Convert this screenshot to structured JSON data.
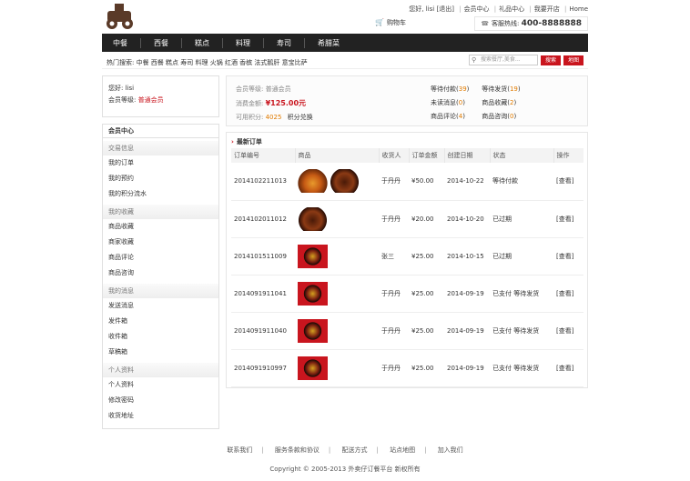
{
  "header": {
    "greeting": "您好,",
    "username": "lisi",
    "logout": "[退出]",
    "member_center": "会员中心",
    "gift_center": "礼品中心",
    "join_store": "我要开店",
    "home": "Home",
    "cart": "购物车",
    "hotline_label": "客服热线:",
    "hotline_number": "400-8888888"
  },
  "nav": [
    "中餐",
    "西餐",
    "糕点",
    "料理",
    "寿司",
    "希腊菜"
  ],
  "hot_search": {
    "label": "热门搜索:",
    "words": "中餐 西餐 糕点 寿司 料理 火锅 红酒 香槟 法式鹅肝 意宝比萨"
  },
  "search": {
    "placeholder": "搜索餐厅,美食...",
    "search_btn": "搜索",
    "map_btn": "地图"
  },
  "user": {
    "hello_label": "您好:",
    "name": "lisi",
    "level_label": "会员等级:",
    "level": "普通会员"
  },
  "menu": {
    "title": "会员中心",
    "sections": [
      {
        "title": "交易信息",
        "items": [
          "我的订单",
          "我的预约",
          "我的积分流水"
        ]
      },
      {
        "title": "我的收藏",
        "items": [
          "商品收藏",
          "商家收藏",
          "商品评论",
          "商品咨询"
        ]
      },
      {
        "title": "我的消息",
        "items": [
          "发送消息",
          "发件箱",
          "收件箱",
          "草稿箱"
        ]
      },
      {
        "title": "个人资料",
        "items": [
          "个人资料",
          "修改密码",
          "收货地址"
        ]
      }
    ]
  },
  "info": {
    "level_label": "会员等级:",
    "level": "普通会员",
    "balance_label": "消费金额:",
    "balance": "¥125.00元",
    "points_label": "可用积分:",
    "points": "4025",
    "redeem": "积分兑换",
    "stats": [
      [
        "等待付款",
        "39",
        "等待发货",
        "19"
      ],
      [
        "未读消息",
        "0",
        "商品收藏",
        "2"
      ],
      [
        "商品评论",
        "4",
        "商品咨询",
        "0"
      ]
    ]
  },
  "orders": {
    "title": "最新订单",
    "columns": [
      "订单编号",
      "商品",
      "收货人",
      "订单金额",
      "创建日期",
      "状态",
      "操作"
    ],
    "rows": [
      {
        "id": "2014102211013",
        "receiver": "于丹丹",
        "amount": "¥50.00",
        "date": "2014-10-22",
        "status": "等待付款",
        "action": "[查看]"
      },
      {
        "id": "2014102011012",
        "receiver": "于丹丹",
        "amount": "¥20.00",
        "date": "2014-10-20",
        "status": "已过期",
        "action": "[查看]"
      },
      {
        "id": "2014101511009",
        "receiver": "张三",
        "amount": "¥25.00",
        "date": "2014-10-15",
        "status": "已过期",
        "action": "[查看]"
      },
      {
        "id": "2014091911041",
        "receiver": "于丹丹",
        "amount": "¥25.00",
        "date": "2014-09-19",
        "status": "已支付 等待发货",
        "action": "[查看]"
      },
      {
        "id": "2014091911040",
        "receiver": "于丹丹",
        "amount": "¥25.00",
        "date": "2014-09-19",
        "status": "已支付 等待发货",
        "action": "[查看]"
      },
      {
        "id": "2014091910997",
        "receiver": "于丹丹",
        "amount": "¥25.00",
        "date": "2014-09-19",
        "status": "已支付 等待发货",
        "action": "[查看]"
      }
    ]
  },
  "footer": {
    "links": [
      "联系我们",
      "服务条款和协议",
      "配送方式",
      "站点地图",
      "加入我们"
    ],
    "copyright": "Copyright © 2005-2013 外卖仔订餐平台 新权所有"
  },
  "colors": {
    "accent": "#c9151e",
    "nav_bg": "#222222",
    "orange": "#e07b00"
  }
}
